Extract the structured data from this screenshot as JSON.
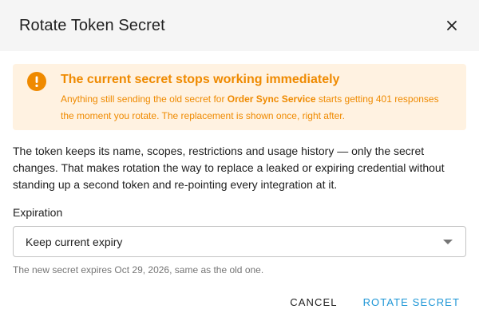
{
  "dialog": {
    "title": "Rotate Token Secret",
    "close_icon": "close-icon"
  },
  "alert": {
    "icon": "warning-icon",
    "title": "The current secret stops working immediately",
    "text_before": "Anything still sending the old secret for ",
    "text_strong": "Order Sync Service",
    "text_after": " starts getting 401 responses the moment you rotate. The replacement is shown once, right after.",
    "color": "#ef8a00",
    "background": "#fff2e1"
  },
  "description": "The token keeps its name, scopes, restrictions and usage history — only the secret changes. That makes rotation the way to replace a leaked or expiring credential without standing up a second token and re-pointing every integration at it.",
  "expiration": {
    "label": "Expiration",
    "selected": "Keep current expiry",
    "helper": "The new secret expires Oct 29, 2026, same as the old one."
  },
  "actions": {
    "cancel": "CANCEL",
    "confirm": "ROTATE SECRET",
    "primary_color": "#1e96d6"
  }
}
